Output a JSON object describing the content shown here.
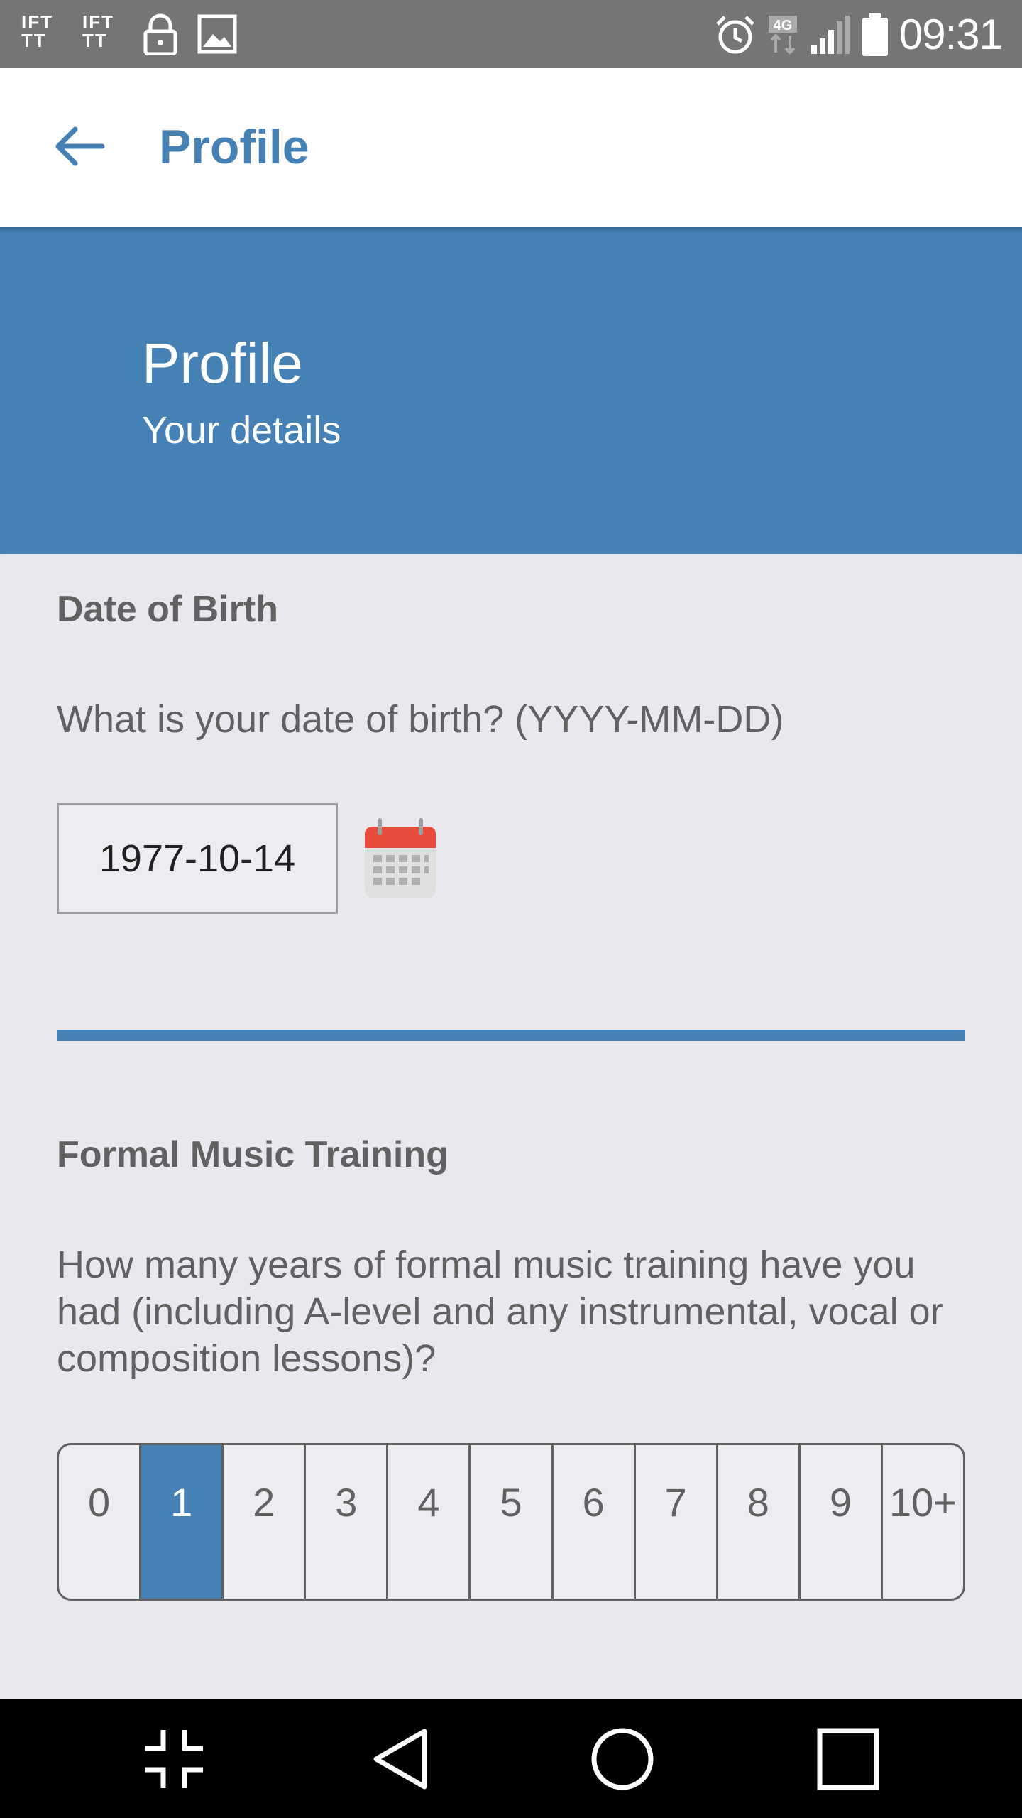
{
  "status_bar": {
    "time": "09:31",
    "ifttt_1": "IFTTT",
    "ifttt_2": "IFTTT",
    "network": "4G"
  },
  "toolbar": {
    "title": "Profile"
  },
  "hero": {
    "title": "Profile",
    "subtitle": "Your details"
  },
  "dob": {
    "label": "Date of Birth",
    "question": "What is your date of birth? (YYYY-MM-DD)",
    "value": "1977-10-14"
  },
  "music": {
    "label": "Formal Music Training",
    "question": "How many years of formal music training have you had (including A-level and any instrumental, vocal or composition lessons)?",
    "options": [
      "0",
      "1",
      "2",
      "3",
      "4",
      "5",
      "6",
      "7",
      "8",
      "9",
      "10+"
    ],
    "selected": "1"
  },
  "colors": {
    "accent": "#4581b5",
    "background": "#e8e8ee",
    "status_bar": "#757575"
  }
}
